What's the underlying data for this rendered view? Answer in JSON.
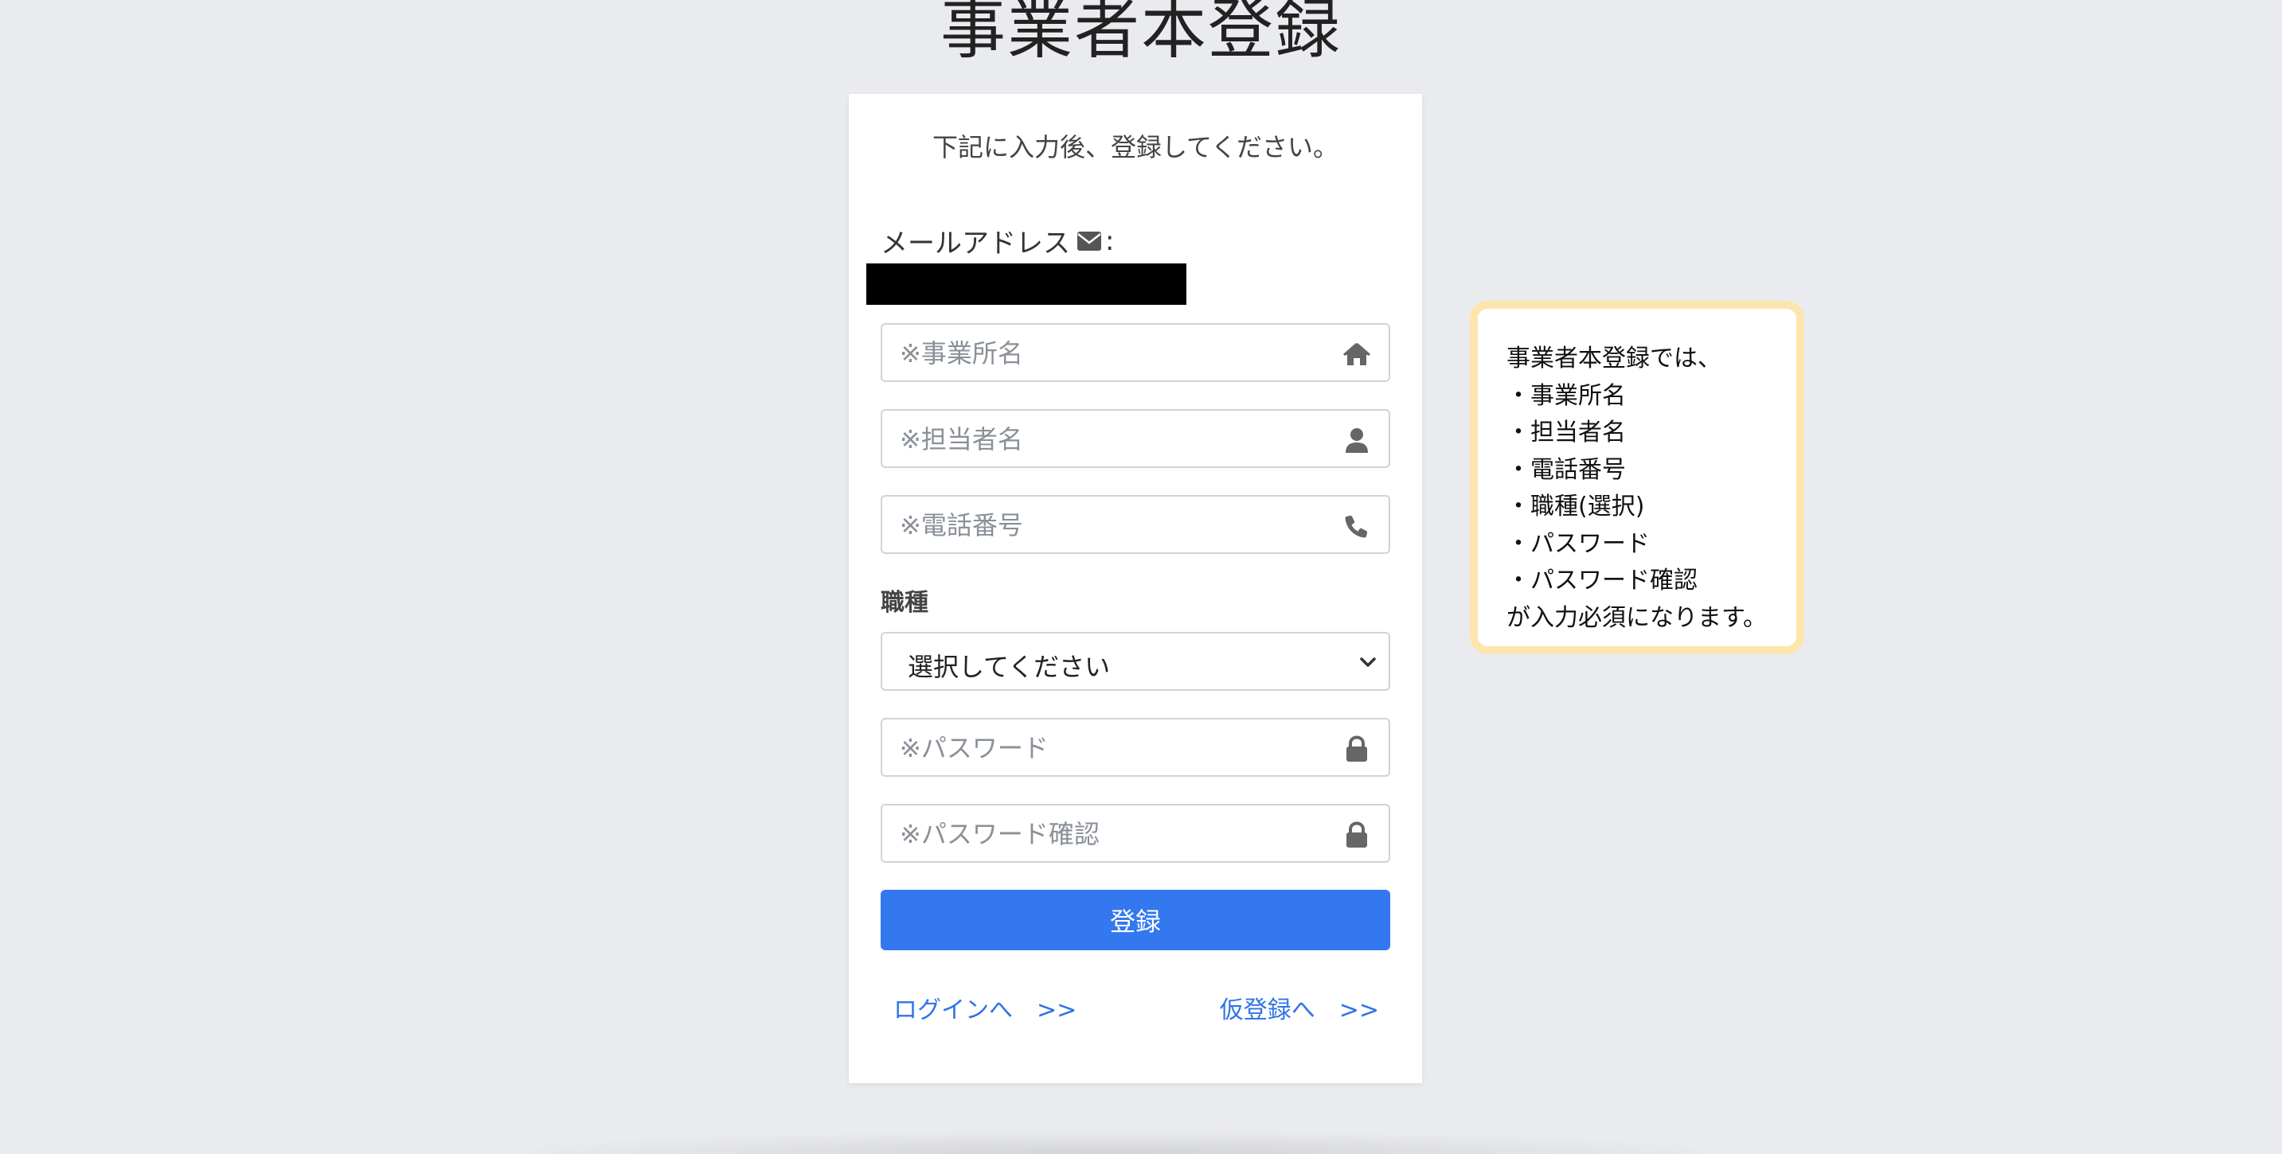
{
  "page": {
    "title": "事業者本登録"
  },
  "form": {
    "subtitle": "下記に入力後、登録してください。",
    "email_label": "メールアドレス",
    "email_colon": ":",
    "fields": {
      "business_name": {
        "placeholder": "※事業所名",
        "icon": "home-icon"
      },
      "person_name": {
        "placeholder": "※担当者名",
        "icon": "user-icon"
      },
      "phone": {
        "placeholder": "※電話番号",
        "icon": "phone-icon"
      },
      "password": {
        "placeholder": "※パスワード",
        "icon": "lock-icon"
      },
      "password_confirm": {
        "placeholder": "※パスワード確認",
        "icon": "lock-icon"
      }
    },
    "occupation": {
      "label": "職種",
      "selected": "選択してください"
    },
    "submit_label": "登録",
    "links": {
      "login": "ログインへ　>>",
      "pre_register": "仮登録へ　>>"
    }
  },
  "notice": {
    "lines": [
      "事業者本登録では、",
      "・事業所名",
      "・担当者名",
      "・電話番号",
      "・職種(選択)",
      "・パスワード",
      "・パスワード確認",
      "が入力必須になります。"
    ]
  },
  "colors": {
    "background": "#eaebef",
    "accent": "#3478f0",
    "link": "#2f74e6",
    "notice_border": "#fde6ad"
  }
}
